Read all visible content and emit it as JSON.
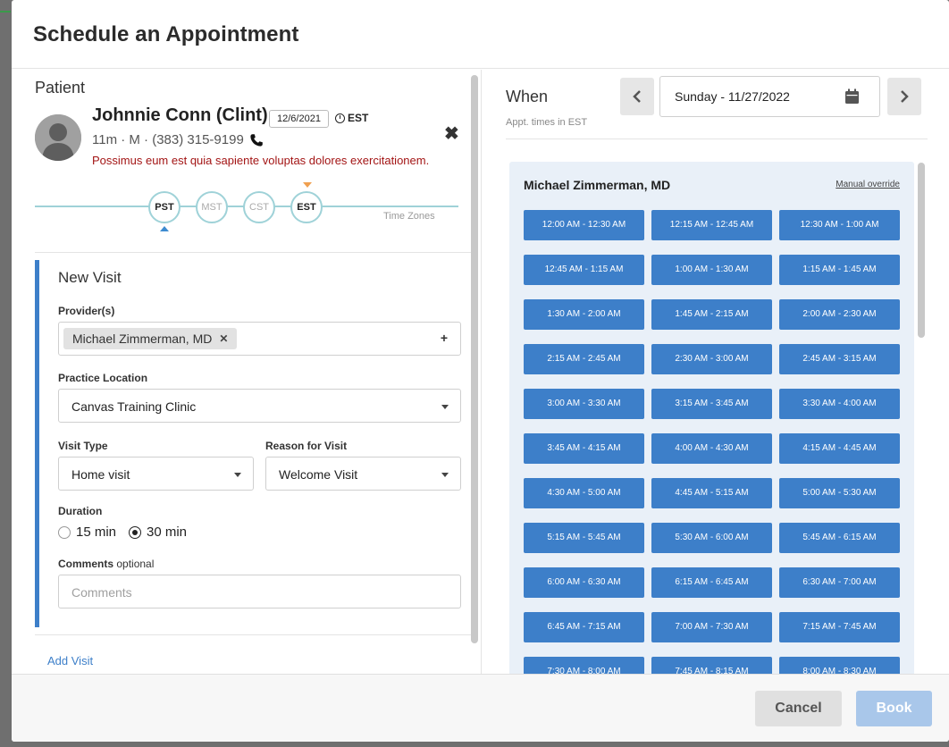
{
  "modal": {
    "title": "Schedule an Appointment"
  },
  "patient": {
    "section_label": "Patient",
    "name": "Johnnie Conn (Clint)",
    "dob": "12/6/2021",
    "timezone": "EST",
    "meta": "11m · M · (383) 315-9199",
    "note": "Possimus eum est quia sapiente voluptas dolores exercitationem."
  },
  "timezones": {
    "label": "Time Zones",
    "options": [
      "PST",
      "MST",
      "CST",
      "EST"
    ],
    "active": [
      "PST",
      "EST"
    ]
  },
  "visit": {
    "title": "New Visit",
    "provider_label": "Provider(s)",
    "provider_chip": "Michael Zimmerman, MD",
    "location_label": "Practice Location",
    "location_value": "Canvas Training Clinic",
    "visit_type_label": "Visit Type",
    "visit_type_value": "Home visit",
    "reason_label": "Reason for Visit",
    "reason_value": "Welcome Visit",
    "duration_label": "Duration",
    "duration_options": [
      "15 min",
      "30 min"
    ],
    "duration_selected": "30 min",
    "comments_label": "Comments",
    "comments_optional": "optional",
    "comments_placeholder": "Comments",
    "add_visit_link": "Add Visit"
  },
  "when": {
    "label": "When",
    "subtext": "Appt. times in EST",
    "date": "Sunday - 11/27/2022"
  },
  "slots": {
    "provider": "Michael Zimmerman, MD",
    "override_label": "Manual override",
    "times": [
      "12:00 AM - 12:30 AM",
      "12:15 AM - 12:45 AM",
      "12:30 AM - 1:00 AM",
      "12:45 AM - 1:15 AM",
      "1:00 AM - 1:30 AM",
      "1:15 AM - 1:45 AM",
      "1:30 AM - 2:00 AM",
      "1:45 AM - 2:15 AM",
      "2:00 AM - 2:30 AM",
      "2:15 AM - 2:45 AM",
      "2:30 AM - 3:00 AM",
      "2:45 AM - 3:15 AM",
      "3:00 AM - 3:30 AM",
      "3:15 AM - 3:45 AM",
      "3:30 AM - 4:00 AM",
      "3:45 AM - 4:15 AM",
      "4:00 AM - 4:30 AM",
      "4:15 AM - 4:45 AM",
      "4:30 AM - 5:00 AM",
      "4:45 AM - 5:15 AM",
      "5:00 AM - 5:30 AM",
      "5:15 AM - 5:45 AM",
      "5:30 AM - 6:00 AM",
      "5:45 AM - 6:15 AM",
      "6:00 AM - 6:30 AM",
      "6:15 AM - 6:45 AM",
      "6:30 AM - 7:00 AM",
      "6:45 AM - 7:15 AM",
      "7:00 AM - 7:30 AM",
      "7:15 AM - 7:45 AM",
      "7:30 AM - 8:00 AM",
      "7:45 AM - 8:15 AM",
      "8:00 AM - 8:30 AM"
    ]
  },
  "footer": {
    "cancel_label": "Cancel",
    "book_label": "Book"
  },
  "colors": {
    "primary": "#3d7fc9",
    "slot_panel": "#e9f0f8",
    "warning_text": "#a31515",
    "timeline": "#9fd2d8",
    "book_disabled": "#a9c7ea"
  }
}
